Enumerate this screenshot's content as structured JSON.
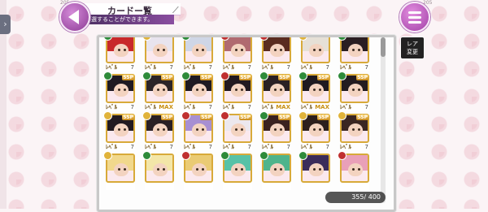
{
  "header": {
    "title": "カードー覧",
    "subtitle": "選することができます。",
    "corner_left": "205",
    "corner_right": "205"
  },
  "side_tab": {
    "icon": "chevron-right-icon",
    "glyph": "›"
  },
  "rare_button": {
    "line1": "レア",
    "line2": "変更"
  },
  "count": {
    "current": "355",
    "max": "400",
    "text": "355/ 400"
  },
  "colors": {
    "gold_border": "#d8aa39",
    "menu_purple": "#a13fa6",
    "panel_border": "#c8c8c8"
  },
  "cards": [
    [
      {
        "elem": "#2e8b3a",
        "rank": "",
        "lv": "7",
        "max": false,
        "hair": "#c8282a"
      },
      {
        "elem": "#e0b33a",
        "rank": "",
        "lv": "7",
        "max": false,
        "hair": "#e8e4ee"
      },
      {
        "elem": "#2e8b3a",
        "rank": "",
        "lv": "7",
        "max": false,
        "hair": "#cfd6e6"
      },
      {
        "elem": "#c03030",
        "rank": "",
        "lv": "7",
        "max": false,
        "hair": "#b06a70"
      },
      {
        "elem": "#c03030",
        "rank": "",
        "lv": "7",
        "max": false,
        "hair": "#5a2c20"
      },
      {
        "elem": "#e0b33a",
        "rank": "",
        "lv": "7",
        "max": false,
        "hair": "#e6e0d6"
      },
      {
        "elem": "#2e8b3a",
        "rank": "",
        "lv": "7",
        "max": false,
        "hair": "#2a1e22"
      }
    ],
    [
      {
        "elem": "#2e8b3a",
        "rank": "SSP",
        "lv": "7",
        "max": false,
        "hair": "#1f1a22"
      },
      {
        "elem": "#2e8b3a",
        "rank": "SSP",
        "lv": "",
        "max": true,
        "hair": "#2b2428"
      },
      {
        "elem": "#2e8b3a",
        "rank": "SSP",
        "lv": "7",
        "max": false,
        "hair": "#1f1a22"
      },
      {
        "elem": "#c03030",
        "rank": "SSP",
        "lv": "7",
        "max": false,
        "hair": "#221a20"
      },
      {
        "elem": "#2e8b3a",
        "rank": "SSP",
        "lv": "",
        "max": true,
        "hair": "#2a2024"
      },
      {
        "elem": "#2e8b3a",
        "rank": "SSP",
        "lv": "",
        "max": true,
        "hair": "#1e1a20"
      },
      {
        "elem": "#2e8b3a",
        "rank": "SSP",
        "lv": "7",
        "max": false,
        "hair": "#231b20"
      }
    ],
    [
      {
        "elem": "#e0b33a",
        "rank": "SSP",
        "lv": "7",
        "max": false,
        "hair": "#221a20"
      },
      {
        "elem": "#e0b33a",
        "rank": "SSP",
        "lv": "7",
        "max": false,
        "hair": "#2a2024"
      },
      {
        "elem": "#c03030",
        "rank": "SSP",
        "lv": "7",
        "max": false,
        "hair": "#a78fd2"
      },
      {
        "elem": "#c03030",
        "rank": "SSP",
        "lv": "7",
        "max": false,
        "hair": "#ece8ee"
      },
      {
        "elem": "#2e8b3a",
        "rank": "SSP",
        "lv": "7",
        "max": false,
        "hair": "#3a2220"
      },
      {
        "elem": "#e0b33a",
        "rank": "SSP",
        "lv": "7",
        "max": false,
        "hair": "#2c1f1d"
      },
      {
        "elem": "#e0b33a",
        "rank": "SSP",
        "lv": "7",
        "max": false,
        "hair": "#3a2622"
      }
    ],
    [
      {
        "elem": "#e0b33a",
        "rank": "",
        "lv": "",
        "max": false,
        "hair": "#f1d88c"
      },
      {
        "elem": "#2e8b3a",
        "rank": "",
        "lv": "",
        "max": false,
        "hair": "#f3e6a8"
      },
      {
        "elem": "#c03030",
        "rank": "",
        "lv": "",
        "max": false,
        "hair": "#eacb74"
      },
      {
        "elem": "#2e8b3a",
        "rank": "",
        "lv": "",
        "max": false,
        "hair": "#57c2a7"
      },
      {
        "elem": "#2e8b3a",
        "rank": "",
        "lv": "",
        "max": false,
        "hair": "#4fb48c"
      },
      {
        "elem": "#2e8b3a",
        "rank": "",
        "lv": "",
        "max": false,
        "hair": "#3a2c5a"
      },
      {
        "elem": "#c03030",
        "rank": "",
        "lv": "",
        "max": false,
        "hair": "#e9a0b8"
      }
    ]
  ],
  "labels": {
    "lv_prefix": "ﾚﾍﾞﾙ",
    "max_text": "MAX"
  }
}
